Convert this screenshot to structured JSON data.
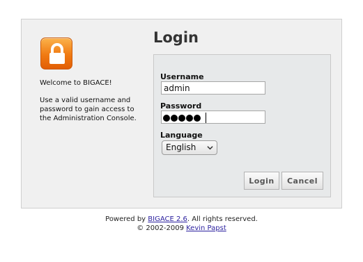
{
  "sidebar": {
    "welcome": "Welcome to BIGACE!",
    "description": "Use a valid username and password to gain access to the Administration Console.",
    "icon": "lock-icon"
  },
  "form": {
    "title": "Login",
    "username_label": "Username",
    "username_value": "admin",
    "password_label": "Password",
    "password_masked_length": 5,
    "language_label": "Language",
    "language_selected": "English",
    "login_button": "Login",
    "cancel_button": "Cancel"
  },
  "footer": {
    "powered_prefix": "Powered by",
    "powered_link": "BIGACE 2.6",
    "powered_suffix": ". All rights reserved.",
    "copyright_prefix": "© 2002-2009",
    "author_link": "Kevin Papst"
  },
  "colors": {
    "panel_bg": "#f0f0f0",
    "form_bg": "#e7e9ea",
    "icon_orange": "#f07a12",
    "link": "#2a1f9e"
  }
}
